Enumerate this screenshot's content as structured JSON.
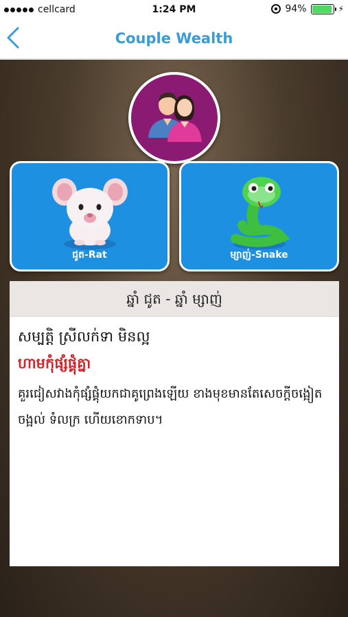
{
  "status_bar": {
    "carrier": "cellcard",
    "time": "1:24 PM",
    "battery_percent": "94%",
    "battery_level": 0.94
  },
  "nav": {
    "back_icon": "chevron-left-icon",
    "back_glyph": "<",
    "title": "Couple Wealth"
  },
  "header_icon": "couple-icon",
  "cards": [
    {
      "label": "ជូត-Rat",
      "icon": "rat-icon"
    },
    {
      "label": "ម្សាញ់-Snake",
      "icon": "snake-icon"
    }
  ],
  "result": {
    "header": "ឆ្នាំ ជូត - ឆ្នាំ ម្សាញ់",
    "title": "សម្បត្តិ ស្រីលក់ទា មិនល្អ",
    "subtitle": "ហាមកុំផ្សំផ្គុំគ្នា",
    "body": "គួរជៀសវាងកុំផ្សំផ្គុំយកជាគូព្រេងឡើយ ខាងមុខមានតែសេចក្តីចង្អៀតចង្អល់ ទំលក្រ ហើយខោកទាប។"
  },
  "colors": {
    "accent": "#3a9bd9",
    "card_blue": "#1e90e2",
    "circle_purple": "#8b1a73",
    "warning_red": "#d0242a"
  }
}
